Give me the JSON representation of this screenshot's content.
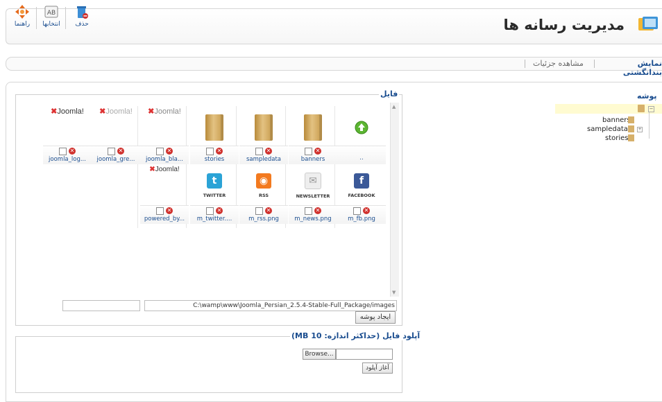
{
  "toolbar": {
    "help_label": "راهنما",
    "options_label": "انتخابها",
    "delete_label": "حذف"
  },
  "page": {
    "title": "مدیریت رسانه ها"
  },
  "subnav": {
    "thumbnail_view": "نمایش بندانگشتی",
    "detail_view": "مشاهده جزئیات"
  },
  "folders_panel": {
    "title": "پوشه",
    "tree": [
      "banners",
      "sampledata",
      "stories"
    ]
  },
  "files_panel": {
    "legend": "فایل",
    "up_label": "..",
    "items_row1": [
      {
        "name": "banners"
      },
      {
        "name": "sampledata"
      },
      {
        "name": "stories"
      },
      {
        "name": "joomla_bla..."
      },
      {
        "name": "joomla_gre..."
      },
      {
        "name": "joomla_log..."
      }
    ],
    "items_row2": [
      {
        "name": "m_fb.png",
        "caption": "FACEBOOK",
        "glyph": "f",
        "color": "#3b5998"
      },
      {
        "name": "m_news.png",
        "caption": "NEWSLETTER",
        "glyph": "✉",
        "color": "#e8e8e8"
      },
      {
        "name": "m_rss.png",
        "caption": "RSS",
        "glyph": "◉",
        "color": "#f37a1f"
      },
      {
        "name": "m_twitter....",
        "caption": "TWITTER",
        "glyph": "t",
        "color": "#2ba3d6"
      },
      {
        "name": "powered_by...",
        "caption": "Joomla!",
        "glyph": "",
        "color": ""
      }
    ],
    "joomla_brand": "Joomla!",
    "path_value": "C:\\wamp\\www\\Joomla_Persian_2.5.4-Stable-Full_Package/images",
    "folder_name_value": "",
    "create_folder_label": "ایجاد پوشه"
  },
  "upload_panel": {
    "legend": "آپلود فایل (حداکثر اندازه: 10 MB)",
    "browse_label": "Browse...",
    "start_upload_label": "آغاز آپلود"
  },
  "colors": {
    "link": "#1a4d8f",
    "delete": "#d0312d",
    "folder": "#d6b06a"
  }
}
